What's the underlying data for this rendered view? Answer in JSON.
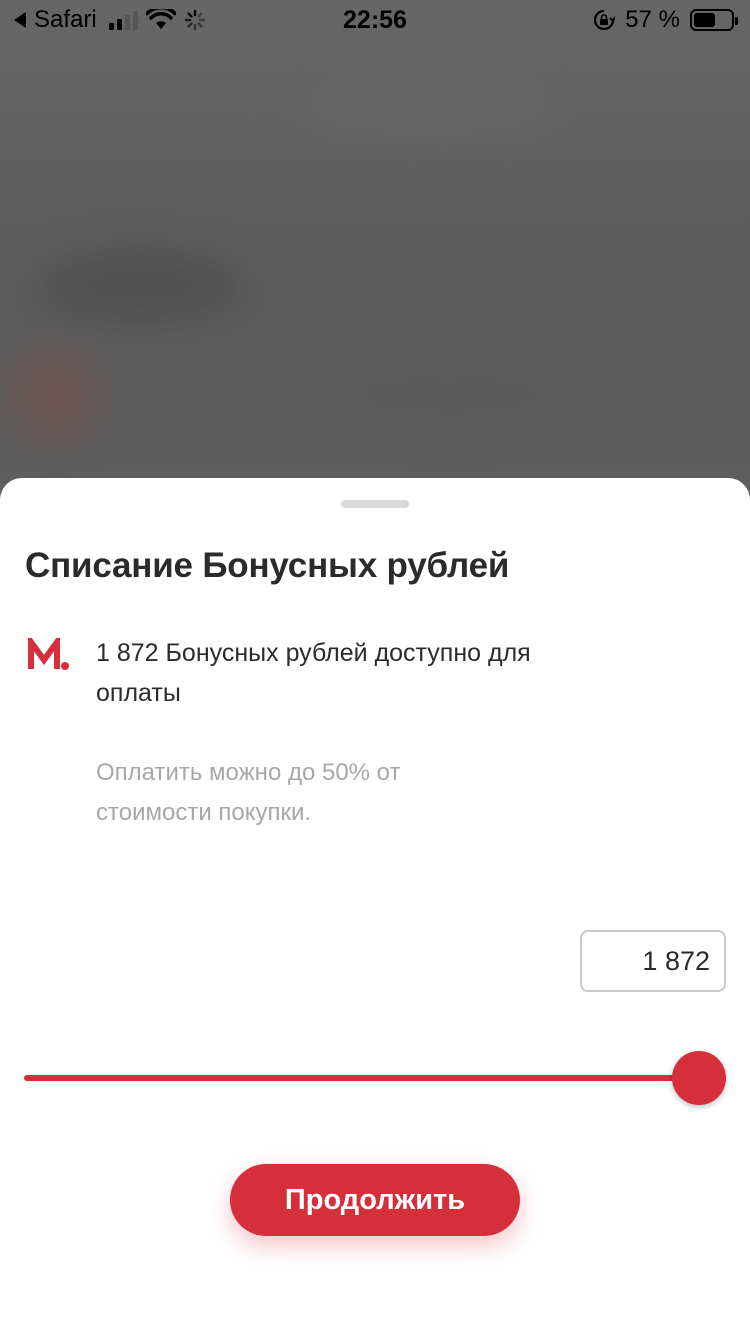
{
  "status_bar": {
    "back_app": "Safari",
    "time": "22:56",
    "battery": "57 %",
    "battery_level": 0.57
  },
  "sheet": {
    "title": "Списание Бонусных рублей",
    "available_text": "1 872 Бонусных рублей доступно для оплаты",
    "hint_text": "Оплатить можно до 50% от стоимости покупки.",
    "amount_value": "1 872",
    "slider_level": 1.0,
    "continue_label": "Продолжить"
  },
  "colors": {
    "accent": "#d62f3c",
    "title": "#2b2b2b",
    "hint": "#a7a7a7",
    "backdrop": "#5e5e5e"
  },
  "icons": {
    "logo": "m-logo-icon",
    "back": "back-arrow-icon",
    "signal": "cellular-signal-icon",
    "wifi": "wifi-icon",
    "activity": "activity-spinner-icon",
    "rotation_lock": "rotation-lock-icon",
    "battery": "battery-icon"
  }
}
